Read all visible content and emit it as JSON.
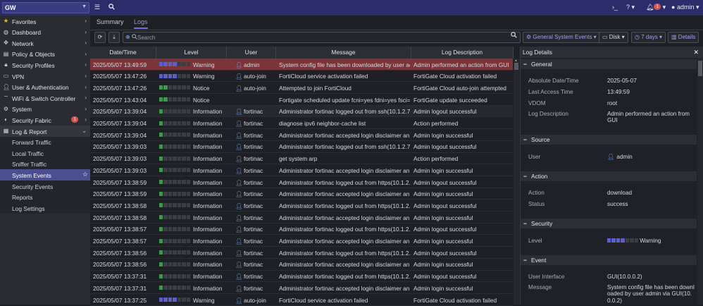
{
  "topbar": {
    "device": "GW",
    "admin": "admin",
    "alert_count": "1"
  },
  "sidebar": {
    "items": [
      {
        "label": "Favorites",
        "icon": "star-icon",
        "arrow": "›"
      },
      {
        "label": "Dashboard",
        "icon": "dashboard-icon",
        "arrow": "›"
      },
      {
        "label": "Network",
        "icon": "network-icon",
        "arrow": "›"
      },
      {
        "label": "Policy & Objects",
        "icon": "policy-icon",
        "arrow": "›"
      },
      {
        "label": "Security Profiles",
        "icon": "lock-icon",
        "arrow": "›"
      },
      {
        "label": "VPN",
        "icon": "vpn-icon",
        "arrow": "›"
      },
      {
        "label": "User & Authentication",
        "icon": "user-icon",
        "arrow": "›"
      },
      {
        "label": "WiFi & Switch Controller",
        "icon": "wifi-icon",
        "arrow": "›"
      },
      {
        "label": "System",
        "icon": "gear-icon",
        "arrow": "›"
      },
      {
        "label": "Security Fabric",
        "icon": "fabric-icon",
        "arrow": "›",
        "badge": "1"
      },
      {
        "label": "Log & Report",
        "icon": "chart-icon",
        "arrow": "⌄"
      }
    ],
    "sub_items": [
      "Forward Traffic",
      "Local Traffic",
      "Sniffer Traffic",
      "System Events",
      "Security Events",
      "Reports",
      "Log Settings"
    ]
  },
  "tabs": [
    "Summary",
    "Logs"
  ],
  "toolbar": {
    "search_placeholder": "Search",
    "filter": "General System Events",
    "source": "Disk",
    "range": "7 days",
    "details": "Details"
  },
  "table": {
    "headers": [
      "Date/Time",
      "Level",
      "User",
      "Message",
      "Log Description"
    ],
    "rows": [
      {
        "time": "2025/05/07 13:49:59",
        "level": "Warning",
        "user": "admin",
        "message": "System config file has been downloaded by user adm...",
        "desc": "Admin performed an action from GUI"
      },
      {
        "time": "2025/05/07 13:47:26",
        "level": "Warning",
        "user": "auto-join",
        "message": "FortiCloud service activation failed",
        "desc": "FortiGate Cloud activation failed"
      },
      {
        "time": "2025/05/07 13:47:26",
        "level": "Notice",
        "user": "auto-join",
        "message": "Attempted to join FortiCloud",
        "desc": "FortiGate Cloud auto-join attempted"
      },
      {
        "time": "2025/05/07 13:43:04",
        "level": "Notice",
        "user": "",
        "message": "Fortigate scheduled update fcni=yes fdni=yes fsci=y...",
        "desc": "FortiGate update succeeded"
      },
      {
        "time": "2025/05/07 13:39:04",
        "level": "Information",
        "user": "fortinac",
        "message": "Administrator fortinac logged out from ssh(10.1.2.71)",
        "desc": "Admin logout successful"
      },
      {
        "time": "2025/05/07 13:39:04",
        "level": "Information",
        "user": "fortinac",
        "message": "diagnose ipv6 neighbor-cache list",
        "desc": "Action performed"
      },
      {
        "time": "2025/05/07 13:39:04",
        "level": "Information",
        "user": "fortinac",
        "message": "Administrator fortinac accepted login disclaimer an...",
        "desc": "Admin login successful"
      },
      {
        "time": "2025/05/07 13:39:03",
        "level": "Information",
        "user": "fortinac",
        "message": "Administrator fortinac logged out from ssh(10.1.2.71)",
        "desc": "Admin logout successful"
      },
      {
        "time": "2025/05/07 13:39:03",
        "level": "Information",
        "user": "fortinac",
        "message": "get system arp",
        "desc": "Action performed"
      },
      {
        "time": "2025/05/07 13:39:03",
        "level": "Information",
        "user": "fortinac",
        "message": "Administrator fortinac accepted login disclaimer an...",
        "desc": "Admin login successful"
      },
      {
        "time": "2025/05/07 13:38:59",
        "level": "Information",
        "user": "fortinac",
        "message": "Administrator fortinac logged out from https(10.1.2....",
        "desc": "Admin logout successful"
      },
      {
        "time": "2025/05/07 13:38:59",
        "level": "Information",
        "user": "fortinac",
        "message": "Administrator fortinac accepted login disclaimer an...",
        "desc": "Admin login successful"
      },
      {
        "time": "2025/05/07 13:38:58",
        "level": "Information",
        "user": "fortinac",
        "message": "Administrator fortinac logged out from https(10.1.2....",
        "desc": "Admin logout successful"
      },
      {
        "time": "2025/05/07 13:38:58",
        "level": "Information",
        "user": "fortinac",
        "message": "Administrator fortinac accepted login disclaimer an...",
        "desc": "Admin login successful"
      },
      {
        "time": "2025/05/07 13:38:57",
        "level": "Information",
        "user": "fortinac",
        "message": "Administrator fortinac logged out from https(10.1.2....",
        "desc": "Admin logout successful"
      },
      {
        "time": "2025/05/07 13:38:57",
        "level": "Information",
        "user": "fortinac",
        "message": "Administrator fortinac accepted login disclaimer an...",
        "desc": "Admin login successful"
      },
      {
        "time": "2025/05/07 13:38:56",
        "level": "Information",
        "user": "fortinac",
        "message": "Administrator fortinac logged out from https(10.1.2....",
        "desc": "Admin logout successful"
      },
      {
        "time": "2025/05/07 13:38:56",
        "level": "Information",
        "user": "fortinac",
        "message": "Administrator fortinac accepted login disclaimer an...",
        "desc": "Admin login successful"
      },
      {
        "time": "2025/05/07 13:37:31",
        "level": "Information",
        "user": "fortinac",
        "message": "Administrator fortinac logged out from https(10.1.2....",
        "desc": "Admin logout successful"
      },
      {
        "time": "2025/05/07 13:37:31",
        "level": "Information",
        "user": "fortinac",
        "message": "Administrator fortinac accepted login disclaimer an...",
        "desc": "Admin login successful"
      },
      {
        "time": "2025/05/07 13:37:25",
        "level": "Warning",
        "user": "auto-join",
        "message": "FortiCloud service activation failed",
        "desc": "FortiGate Cloud activation failed"
      }
    ]
  },
  "details": {
    "title": "Log Details",
    "sections": {
      "general": "General",
      "source": "Source",
      "action": "Action",
      "security": "Security",
      "event": "Event"
    },
    "fields": {
      "absolute_date_k": "Absolute Date/Time",
      "absolute_date_v": "2025-05-07",
      "last_access_k": "Last Access Time",
      "last_access_v": "13:49:59",
      "vdom_k": "VDOM",
      "vdom_v": "root",
      "log_desc_k": "Log Description",
      "log_desc_v": "Admin performed an action from GUI",
      "user_k": "User",
      "user_v": "admin",
      "action_k": "Action",
      "action_v": "download",
      "status_k": "Status",
      "status_v": "success",
      "level_k": "Level",
      "level_v": "Warning",
      "ui_k": "User Interface",
      "ui_v": "GUI(10.0.0.2)",
      "message_k": "Message",
      "message_v": "System config file has been downloaded by user admin via GUI(10.0.0.2)"
    }
  }
}
